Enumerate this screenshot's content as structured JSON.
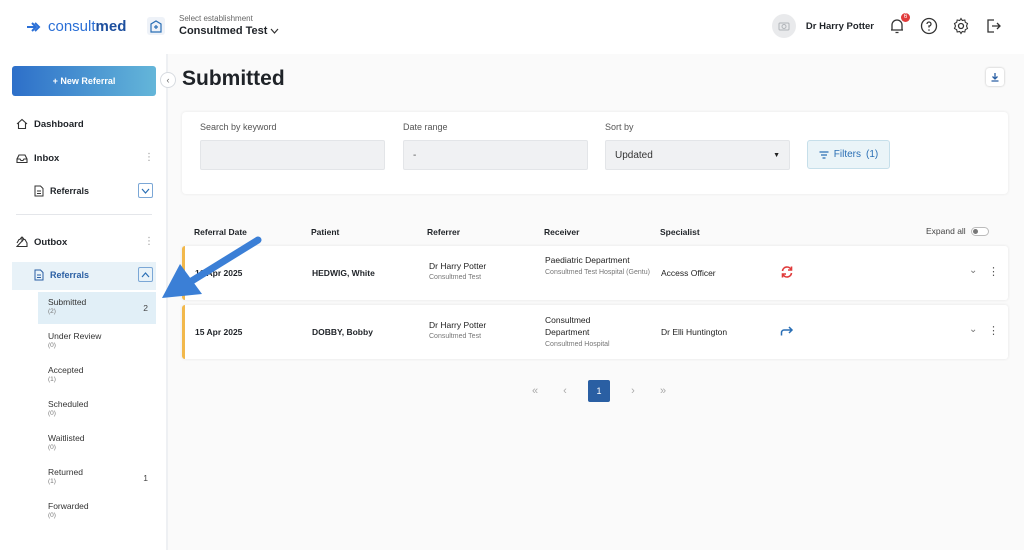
{
  "brand": {
    "logo_a": "consult",
    "logo_b": "med"
  },
  "header": {
    "establishment_label": "Select establishment",
    "establishment_value": "Consultmed Test",
    "user_name": "Dr Harry Potter",
    "notification_count": "6"
  },
  "sidebar": {
    "new_referral": "+ New Referral",
    "dashboard": "Dashboard",
    "inbox": "Inbox",
    "inbox_referrals": "Referrals",
    "outbox": "Outbox",
    "outbox_referrals": "Referrals",
    "statuses": [
      {
        "label": "Submitted",
        "count": "(2)",
        "num": "2"
      },
      {
        "label": "Under Review",
        "count": "(0)",
        "num": ""
      },
      {
        "label": "Accepted",
        "count": "(1)",
        "num": ""
      },
      {
        "label": "Scheduled",
        "count": "(0)",
        "num": ""
      },
      {
        "label": "Waitlisted",
        "count": "(0)",
        "num": ""
      },
      {
        "label": "Returned",
        "count": "(1)",
        "num": "1"
      },
      {
        "label": "Forwarded",
        "count": "(0)",
        "num": ""
      }
    ]
  },
  "main": {
    "title": "Submitted",
    "filters": {
      "keyword_label": "Search by keyword",
      "keyword_value": "",
      "date_label": "Date range",
      "date_value": "-",
      "sort_label": "Sort by",
      "sort_value": "Updated",
      "filters_button": "Filters",
      "filters_count": "(1)"
    },
    "table": {
      "headers": [
        "Referral Date",
        "Patient",
        "Referrer",
        "Receiver",
        "Specialist"
      ],
      "expand_all": "Expand all",
      "rows": [
        {
          "date": "16 Apr 2025",
          "patient": "HEDWIG, White",
          "referrer": "Dr Harry Potter",
          "referrer_org": "Consultmed Test",
          "receiver": "Paediatric Department",
          "receiver_org": "Consultmed Test Hospital (Gentu)",
          "specialist": "Access Officer",
          "status_icon": "sync-icon",
          "status_color": "#e03b3b"
        },
        {
          "date": "15 Apr 2025",
          "patient": "DOBBY, Bobby",
          "referrer": "Dr Harry Potter",
          "referrer_org": "Consultmed Test",
          "receiver": "Consultmed Department",
          "receiver_org": "Consultmed Hospital",
          "specialist": "Dr Elli Huntington",
          "status_icon": "forward-icon",
          "status_color": "#2a6fb5"
        }
      ]
    },
    "pagination": {
      "current": "1"
    }
  },
  "colors": {
    "accent": "#2a5fa3",
    "row_accent": "#f2b84b",
    "arrow": "#3b7fd6"
  }
}
